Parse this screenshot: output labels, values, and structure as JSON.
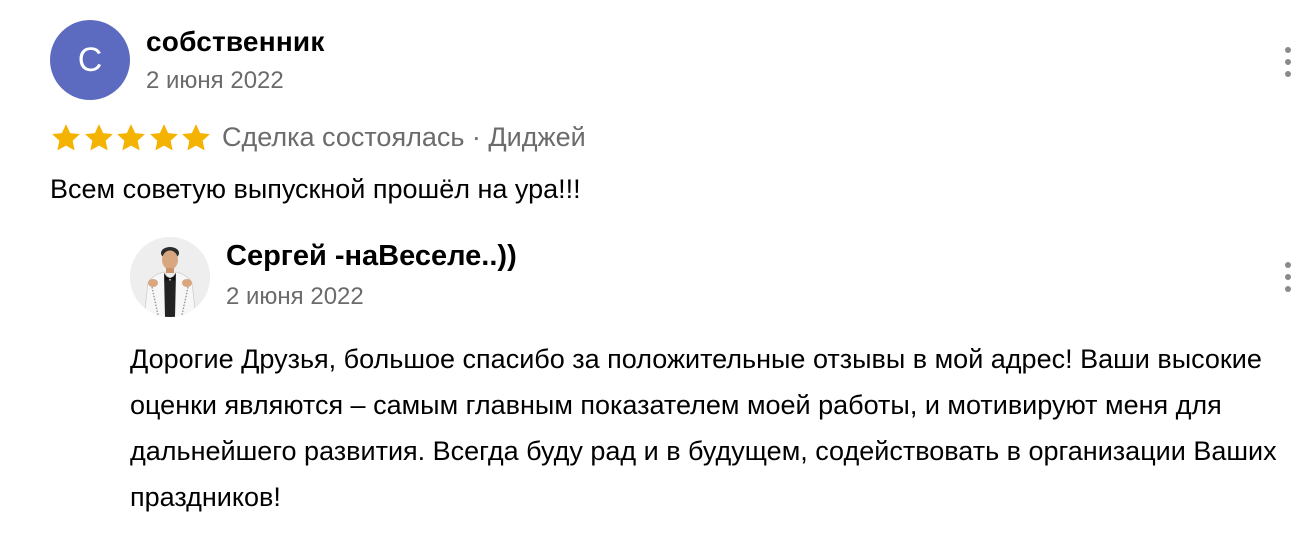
{
  "review": {
    "avatar_letter": "С",
    "author": "собственник",
    "date": "2 июня 2022",
    "rating": 5,
    "rating_max": 5,
    "status": "Сделка состоялась · Диджей",
    "text": "Всем советую выпускной прошёл на ура!!!"
  },
  "reply": {
    "author": "Сергей -наВеселе..))",
    "date": "2 июня 2022",
    "text": "Дорогие Друзья, большое спасибо за положительные отзывы в мой адрес! Ваши высокие оценки являются – самым главным показателем моей работы, и мотивируют меня для дальнейшего развития. Всегда буду рад и в будущем, содействовать в организации Ваших праздников!"
  },
  "colors": {
    "avatar_bg": "#5c6bc0",
    "star": "#f5b301",
    "muted_text": "#6b6b6b"
  },
  "icons": {
    "more": "more-vertical-icon",
    "star": "star-icon"
  }
}
